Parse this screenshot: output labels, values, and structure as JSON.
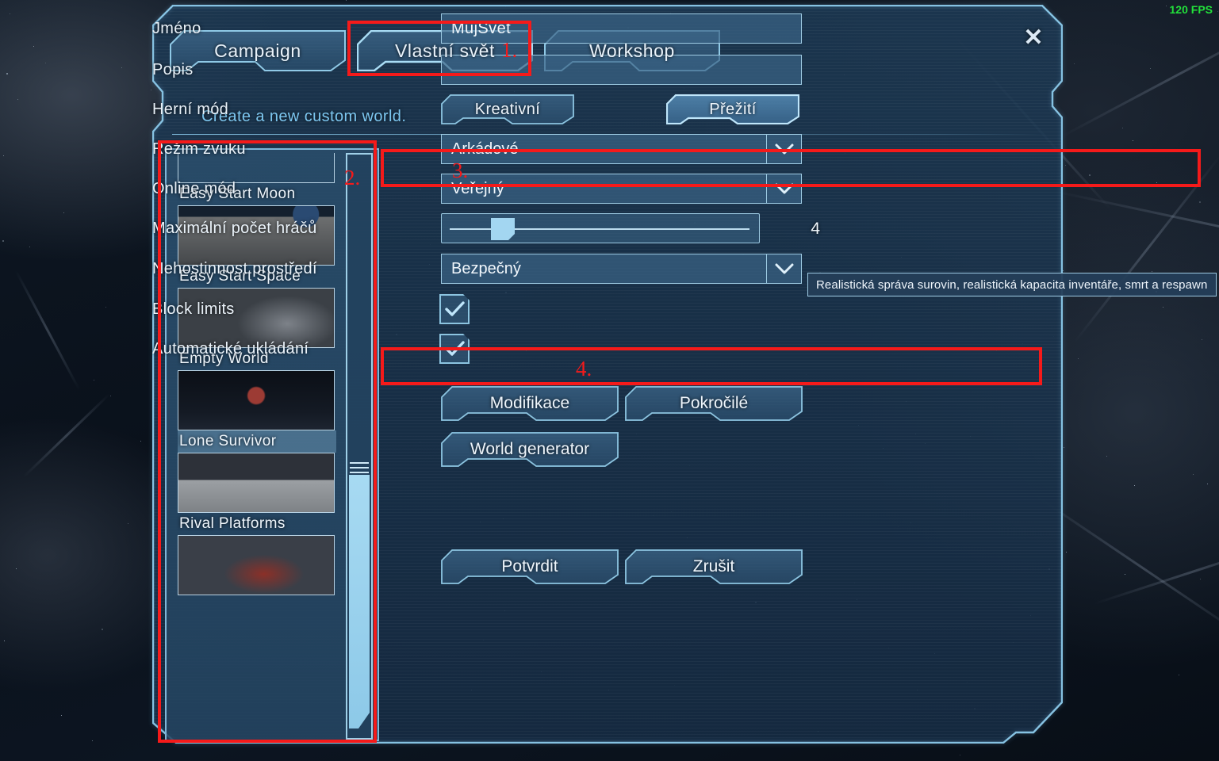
{
  "hud": {
    "fps": "120 FPS"
  },
  "dialog": {
    "close_label": "✕",
    "subtitle": "Create a new custom world.",
    "tabs": [
      {
        "label": "Campaign",
        "selected": false
      },
      {
        "label": "Vlastní svět",
        "selected": true
      },
      {
        "label": "Workshop",
        "selected": false
      }
    ]
  },
  "scenario_list": {
    "items": [
      {
        "label": "Easy Start Moon",
        "selected": false,
        "art": "th-mars"
      },
      {
        "label": "Easy Start Space",
        "selected": false,
        "art": "th-moon"
      },
      {
        "label": "Empty World",
        "selected": false,
        "art": "th-space"
      },
      {
        "label": "Lone Survivor",
        "selected": true,
        "art": "th-empty"
      },
      {
        "label": "Rival Platforms",
        "selected": false,
        "art": "th-lone"
      },
      {
        "label": "",
        "selected": false,
        "art": "th-rival"
      }
    ],
    "scrollbar_position": "lower"
  },
  "form": {
    "name": {
      "label": "Jméno",
      "value": "MujSvet",
      "placeholder": ""
    },
    "description": {
      "label": "Popis",
      "value": "",
      "placeholder": ""
    },
    "game_mode": {
      "label": "Herní mód",
      "options": [
        "Kreativní",
        "Přežití"
      ],
      "selected": "Přežití"
    },
    "sound_mode": {
      "label": "Režim zvuku",
      "value": "Arkádové"
    },
    "online_mode": {
      "label": "Online mód",
      "value": "Veřejný"
    },
    "max_players": {
      "label": "Maximální počet hráčů",
      "value": "4",
      "slider_percent": 18
    },
    "hostility": {
      "label": "Nehostinnost prostředí",
      "value": "Bezpečný"
    },
    "block_limits": {
      "label": "Block limits",
      "checked": true
    },
    "auto_save": {
      "label": "Automatické ukládání",
      "checked": true
    }
  },
  "tooltip": {
    "text": "Realistická správa surovin, realistická kapacita inventáře, smrt a respawn"
  },
  "buttons": {
    "mods": "Modifikace",
    "advanced": "Pokročilé",
    "world_generator": "World generator",
    "confirm": "Potvrdit",
    "cancel": "Zrušit"
  },
  "annotations": [
    {
      "num": "1."
    },
    {
      "num": "2."
    },
    {
      "num": "3."
    },
    {
      "num": "4."
    }
  ],
  "colors": {
    "accent": "#7dc7f0",
    "border": "#9ecbe3",
    "annotation": "#f51a1a",
    "fps": "#22e03a"
  }
}
